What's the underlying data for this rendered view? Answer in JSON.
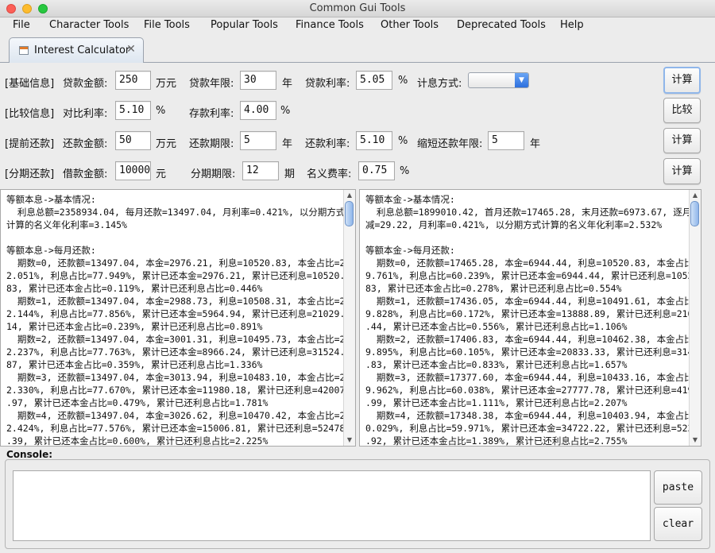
{
  "window": {
    "title": "Common Gui Tools"
  },
  "menubar": {
    "items": [
      "File",
      "Character Tools",
      "File Tools",
      "Popular Tools",
      "Finance Tools",
      "Other Tools",
      "Deprecated Tools",
      "Help"
    ]
  },
  "tab": {
    "label": "Interest Calculator"
  },
  "rows": {
    "basic": {
      "section": "[基础信息]",
      "loan_amount_label": "贷款金额:",
      "loan_amount": "250",
      "loan_amount_unit": "万元",
      "loan_years_label": "贷款年限:",
      "loan_years": "30",
      "loan_years_unit": "年",
      "loan_rate_label": "贷款利率:",
      "loan_rate": "5.05",
      "loan_rate_unit": "%",
      "method_label": "计息方式:",
      "button": "计算"
    },
    "compare": {
      "section": "[比较信息]",
      "compare_rate_label": "对比利率:",
      "compare_rate": "5.10",
      "compare_rate_unit": "%",
      "deposit_rate_label": "存款利率:",
      "deposit_rate": "4.00",
      "deposit_rate_unit": "%",
      "button": "比较"
    },
    "prepay": {
      "section": "[提前还款]",
      "amount_label": "还款金额:",
      "amount": "50",
      "amount_unit": "万元",
      "period_label": "还款期限:",
      "period": "5",
      "period_unit": "年",
      "rate_label": "还款利率:",
      "rate": "5.10",
      "rate_unit": "%",
      "shorten_label": "缩短还款年限:",
      "shorten": "5",
      "shorten_unit": "年",
      "button": "计算"
    },
    "installment": {
      "section": "[分期还款]",
      "amount_label": "借款金额:",
      "amount": "10000",
      "amount_unit": "元",
      "period_label": "分期期限:",
      "period": "12",
      "period_unit": "期",
      "fee_label": "名义费率:",
      "fee": "0.75",
      "fee_unit": "%",
      "button": "计算"
    }
  },
  "results": {
    "left": "等额本息->基本情况:\n  利息总额=2358934.04, 每月还款=13497.04, 月利率=0.421%, 以分期方式\n计算的名义年化利率=3.145%\n\n等额本息->每月还款:\n  期数=0, 还款额=13497.04, 本金=2976.21, 利息=10520.83, 本金占比=2\n2.051%, 利息占比=77.949%, 累计已还本金=2976.21, 累计已还利息=10520.\n83, 累计已还本金占比=0.119%, 累计已还利息占比=0.446%\n  期数=1, 还款额=13497.04, 本金=2988.73, 利息=10508.31, 本金占比=2\n2.144%, 利息占比=77.856%, 累计已还本金=5964.94, 累计已还利息=21029.\n14, 累计已还本金占比=0.239%, 累计已还利息占比=0.891%\n  期数=2, 还款额=13497.04, 本金=3001.31, 利息=10495.73, 本金占比=2\n2.237%, 利息占比=77.763%, 累计已还本金=8966.24, 累计已还利息=31524.\n87, 累计已还本金占比=0.359%, 累计已还利息占比=1.336%\n  期数=3, 还款额=13497.04, 本金=3013.94, 利息=10483.10, 本金占比=2\n2.330%, 利息占比=77.670%, 累计已还本金=11980.18, 累计已还利息=42007\n.97, 累计已还本金占比=0.479%, 累计已还利息占比=1.781%\n  期数=4, 还款额=13497.04, 本金=3026.62, 利息=10470.42, 本金占比=2\n2.424%, 利息占比=77.576%, 累计已还本金=15006.81, 累计已还利息=52478\n.39, 累计已还本金占比=0.600%, 累计已还利息占比=2.225%\n  期数=5, 还款额=13497.04, 本金=3039.36, 利息=10457.68, 本金占比=2",
    "right": "等额本金->基本情况:\n  利息总额=1899010.42, 首月还款=17465.28, 末月还款=6973.67, 逐月递\n减=29.22, 月利率=0.421%, 以分期方式计算的名义年化利率=2.532%\n\n等额本金->每月还款:\n  期数=0, 还款额=17465.28, 本金=6944.44, 利息=10520.83, 本金占比=3\n9.761%, 利息占比=60.239%, 累计已还本金=6944.44, 累计已还利息=10520.\n83, 累计已还本金占比=0.278%, 累计已还利息占比=0.554%\n  期数=1, 还款额=17436.05, 本金=6944.44, 利息=10491.61, 本金占比=3\n9.828%, 利息占比=60.172%, 累计已还本金=13888.89, 累计已还利息=21012\n.44, 累计已还本金占比=0.556%, 累计已还利息占比=1.106%\n  期数=2, 还款额=17406.83, 本金=6944.44, 利息=10462.38, 本金占比=3\n9.895%, 利息占比=60.105%, 累计已还本金=20833.33, 累计已还利息=31474\n.83, 累计已还本金占比=0.833%, 累计已还利息占比=1.657%\n  期数=3, 还款额=17377.60, 本金=6944.44, 利息=10433.16, 本金占比=3\n9.962%, 利息占比=60.038%, 累计已还本金=27777.78, 累计已还利息=41907\n.99, 累计已还本金占比=1.111%, 累计已还利息占比=2.207%\n  期数=4, 还款额=17348.38, 本金=6944.44, 利息=10403.94, 本金占比=4\n0.029%, 利息占比=59.971%, 累计已还本金=34722.22, 累计已还利息=52311\n.92, 累计已还本金占比=1.389%, 累计已还利息占比=2.755%\n  期数=5, 还款额=17319.16, 本金=6944.44, 利息=10374.71, 本金占比=4"
  },
  "console": {
    "label": "Console:",
    "value": "",
    "paste": "paste",
    "clear": "clear"
  }
}
